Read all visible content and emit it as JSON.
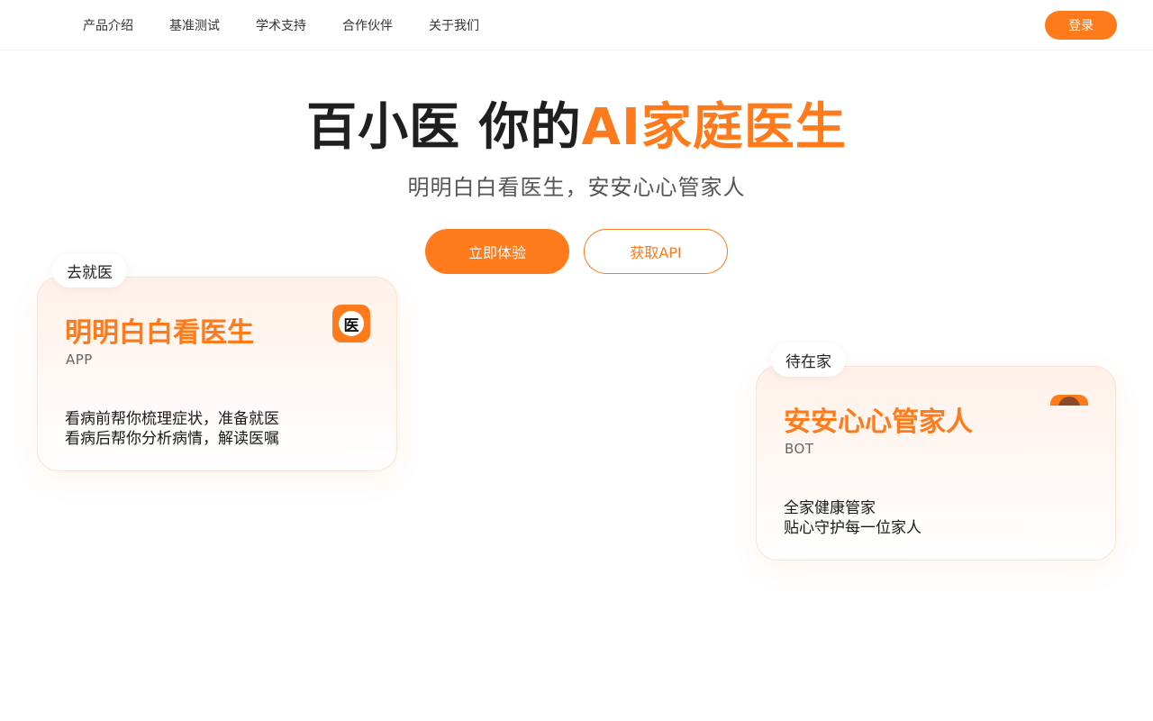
{
  "nav": {
    "items": [
      "产品介绍",
      "基准测试",
      "学术支持",
      "合作伙伴",
      "关于我们"
    ],
    "login_label": "登录"
  },
  "hero": {
    "title_main": "百小医 你的",
    "title_accent": "AI家庭医生",
    "subtitle": "明明白白看医生，安安心心管家人",
    "primary_cta": "立即体验",
    "secondary_cta": "获取API"
  },
  "cards": [
    {
      "tag": "去就医",
      "title": "明明白白看医生",
      "kind": "APP",
      "icon_glyph": "医",
      "lines": [
        "看病前帮你梳理症状，准备就医",
        "看病后帮你分析病情，解读医嘱"
      ]
    },
    {
      "tag": "待在家",
      "title": "安安心心管家人",
      "kind": "BOT",
      "lines": [
        "全家健康管家",
        "贴心守护每一位家人"
      ]
    }
  ],
  "colors": {
    "accent": "#ff7a1a",
    "text_dark": "#1f1f1f",
    "text_muted": "#555555"
  }
}
